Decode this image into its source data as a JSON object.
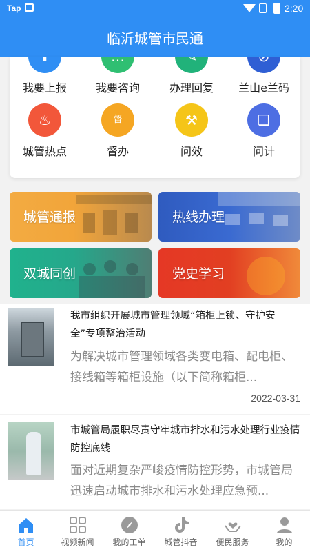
{
  "status_bar": {
    "app_tag": "Tap",
    "time": "2:20"
  },
  "header": {
    "title": "临沂城管市民通"
  },
  "services": [
    {
      "label": "我要上报",
      "icon": "upload-icon",
      "color": "#2f8ef4",
      "glyph": "⬆"
    },
    {
      "label": "我要咨询",
      "icon": "chat-icon",
      "color": "#2fbf72",
      "glyph": "…"
    },
    {
      "label": "办理回复",
      "icon": "edit-icon",
      "color": "#21b27a",
      "glyph": "✎"
    },
    {
      "label": "兰山e兰码",
      "icon": "link-icon",
      "color": "#2f5fd4",
      "glyph": "⊘"
    },
    {
      "label": "城管热点",
      "icon": "flame-icon",
      "color": "#f2573a",
      "glyph": "♨"
    },
    {
      "label": "督办",
      "icon": "shield-icon",
      "color": "#f5a623",
      "glyph": "督"
    },
    {
      "label": "问效",
      "icon": "gavel-icon",
      "color": "#f5c518",
      "glyph": "⚒"
    },
    {
      "label": "问计",
      "icon": "book-icon",
      "color": "#4d6ee3",
      "glyph": "❑"
    }
  ],
  "tiles": [
    {
      "label": "城管通报"
    },
    {
      "label": "热线办理"
    },
    {
      "label": "双城同创"
    },
    {
      "label": "党史学习"
    }
  ],
  "news": [
    {
      "title": "我市组织开展城市管理领域“箱柜上锁、守护安全”专项整治活动",
      "desc": "为解决城市管理领域各类变电箱、配电柜、接线箱等箱柜设施（以下简称箱柜...",
      "date": "2022-03-31"
    },
    {
      "title": "市城管局履职尽责守牢城市排水和污水处理行业疫情防控底线",
      "desc": "面对近期复杂严峻疫情防控形势，市城管局迅速启动城市排水和污水处理应急预..."
    }
  ],
  "nav": [
    {
      "label": "首页",
      "icon": "home-icon",
      "active": true
    },
    {
      "label": "视频新闻",
      "icon": "grid-icon",
      "active": false
    },
    {
      "label": "我的工单",
      "icon": "compass-icon",
      "active": false
    },
    {
      "label": "城管抖音",
      "icon": "tiktok-icon",
      "active": false
    },
    {
      "label": "便民服务",
      "icon": "heart-hands-icon",
      "active": false
    },
    {
      "label": "我的",
      "icon": "user-icon",
      "active": false
    }
  ],
  "colors": {
    "primary": "#2f8ef4"
  }
}
